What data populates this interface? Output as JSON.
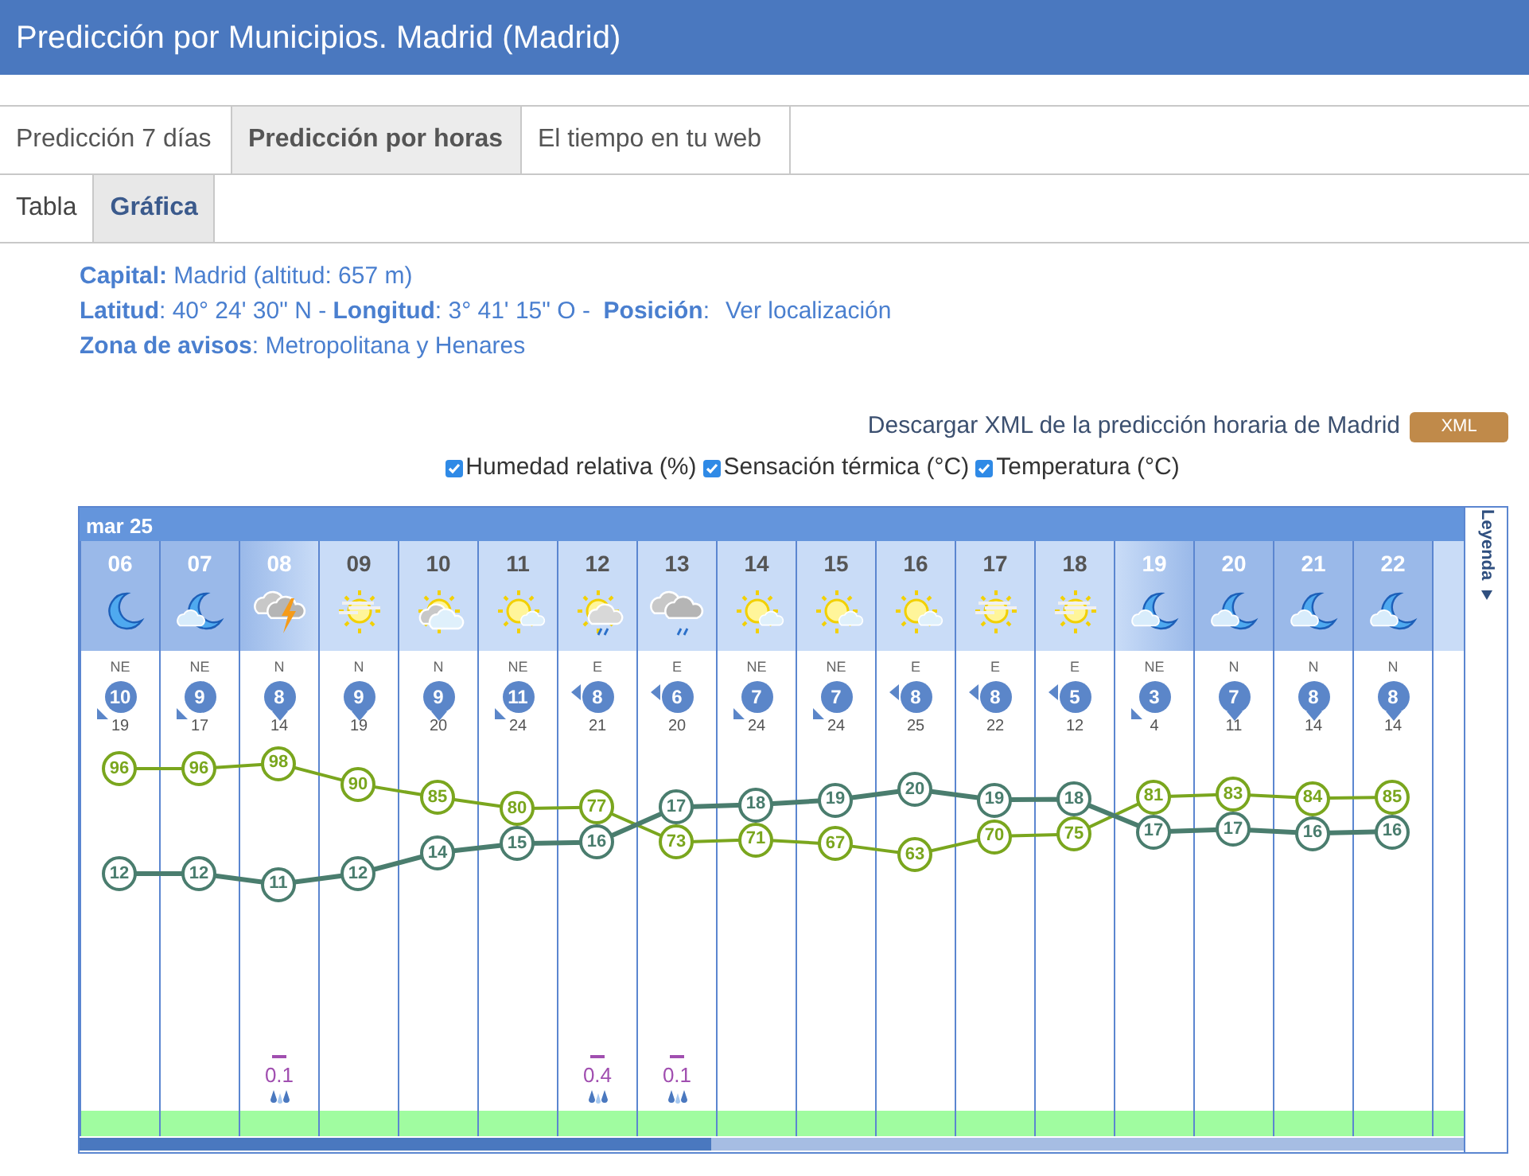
{
  "window": {
    "title": "Predicción por Municipios. Madrid (Madrid)"
  },
  "tabs": [
    {
      "label": "Predicción 7 días",
      "selected": false
    },
    {
      "label": "Predicción por horas",
      "selected": true
    },
    {
      "label": "El tiempo en tu web",
      "selected": false
    }
  ],
  "subtabs": [
    {
      "label": "Tabla",
      "selected": false
    },
    {
      "label": "Gráfica",
      "selected": true
    }
  ],
  "info": [
    {
      "kind": "text",
      "text": "**Capital:** Madrid (altitud: 657 m)"
    },
    {
      "kind": "link",
      "text": "**Latitud**: 40° 24' 30\" N - **Longitud**: 3° 41' 15\" O -  **Posición**:",
      "link": "Ver localización"
    },
    {
      "kind": "text",
      "text": "**Zona de avisos**: Metropolitana y Henares"
    }
  ],
  "download": {
    "text": "Descargar XML de la predicción horaria de Madrid",
    "button": "XML"
  },
  "series_toggles": [
    {
      "label": "Humedad relativa (%)",
      "checked": true
    },
    {
      "label": "Sensación térmica (°C)",
      "checked": true
    },
    {
      "label": "Temperatura (°C)",
      "checked": true
    }
  ],
  "chart": {
    "date": "mar 25",
    "legend": "Leyenda",
    "hours": [
      {
        "hour": "06",
        "header": {
          "kind": "night"
        },
        "sky": {
          "kind": "moon"
        },
        "wind_dir": "NE",
        "wind": "10",
        "wind_arrow": {
          "kind": "sw"
        },
        "gust": "19",
        "humidity": "96",
        "temperature": "12"
      },
      {
        "hour": "07",
        "header": {
          "kind": "night"
        },
        "sky": {
          "kind": "moon_cloud"
        },
        "wind_dir": "NE",
        "wind": "9",
        "wind_arrow": {
          "kind": "sw"
        },
        "gust": "17",
        "humidity": "96",
        "temperature": "12"
      },
      {
        "hour": "08",
        "header": {
          "kind": "dawn"
        },
        "sky": {
          "kind": "storm"
        },
        "wind_dir": "N",
        "wind": "8",
        "wind_arrow": {
          "kind": "s"
        },
        "gust": "14",
        "humidity": "98",
        "temperature": "11",
        "rain": "0.1"
      },
      {
        "hour": "09",
        "header": {
          "kind": "day"
        },
        "sky": {
          "kind": "sun_haze"
        },
        "wind_dir": "N",
        "wind": "9",
        "wind_arrow": {
          "kind": "s"
        },
        "gust": "19",
        "humidity": "90",
        "temperature": "12"
      },
      {
        "hour": "10",
        "header": {
          "kind": "day"
        },
        "sky": {
          "kind": "sun_cloud"
        },
        "wind_dir": "N",
        "wind": "9",
        "wind_arrow": {
          "kind": "s"
        },
        "gust": "20",
        "humidity": "85",
        "temperature": "14"
      },
      {
        "hour": "11",
        "header": {
          "kind": "day"
        },
        "sky": {
          "kind": "sun_small_cloud"
        },
        "wind_dir": "NE",
        "wind": "11",
        "wind_arrow": {
          "kind": "sw"
        },
        "gust": "24",
        "humidity": "80",
        "temperature": "15"
      },
      {
        "hour": "12",
        "header": {
          "kind": "day"
        },
        "sky": {
          "kind": "sun_cloud_rain"
        },
        "wind_dir": "E",
        "wind": "8",
        "wind_arrow": {
          "kind": "w"
        },
        "gust": "21",
        "humidity": "77",
        "temperature": "16",
        "rain": "0.4"
      },
      {
        "hour": "13",
        "header": {
          "kind": "day"
        },
        "sky": {
          "kind": "cloud_rain"
        },
        "wind_dir": "E",
        "wind": "6",
        "wind_arrow": {
          "kind": "w"
        },
        "gust": "20",
        "humidity": "73",
        "temperature": "17",
        "rain": "0.1"
      },
      {
        "hour": "14",
        "header": {
          "kind": "day"
        },
        "sky": {
          "kind": "sun_small_cloud"
        },
        "wind_dir": "NE",
        "wind": "7",
        "wind_arrow": {
          "kind": "sw"
        },
        "gust": "24",
        "humidity": "71",
        "temperature": "18"
      },
      {
        "hour": "15",
        "header": {
          "kind": "day"
        },
        "sky": {
          "kind": "sun_small_cloud"
        },
        "wind_dir": "NE",
        "wind": "7",
        "wind_arrow": {
          "kind": "sw"
        },
        "gust": "24",
        "humidity": "67",
        "temperature": "19"
      },
      {
        "hour": "16",
        "header": {
          "kind": "day"
        },
        "sky": {
          "kind": "sun_small_cloud"
        },
        "wind_dir": "E",
        "wind": "8",
        "wind_arrow": {
          "kind": "w"
        },
        "gust": "25",
        "humidity": "63",
        "temperature": "20"
      },
      {
        "hour": "17",
        "header": {
          "kind": "day"
        },
        "sky": {
          "kind": "sun_haze"
        },
        "wind_dir": "E",
        "wind": "8",
        "wind_arrow": {
          "kind": "w"
        },
        "gust": "22",
        "humidity": "70",
        "temperature": "19"
      },
      {
        "hour": "18",
        "header": {
          "kind": "day"
        },
        "sky": {
          "kind": "sun_haze"
        },
        "wind_dir": "E",
        "wind": "5",
        "wind_arrow": {
          "kind": "w"
        },
        "gust": "12",
        "humidity": "75",
        "temperature": "18"
      },
      {
        "hour": "19",
        "header": {
          "kind": "dusk"
        },
        "sky": {
          "kind": "moon_cloud"
        },
        "wind_dir": "NE",
        "wind": "3",
        "wind_arrow": {
          "kind": "sw"
        },
        "gust": "4",
        "humidity": "81",
        "temperature": "17"
      },
      {
        "hour": "20",
        "header": {
          "kind": "night"
        },
        "sky": {
          "kind": "moon_cloud"
        },
        "wind_dir": "N",
        "wind": "7",
        "wind_arrow": {
          "kind": "s"
        },
        "gust": "11",
        "humidity": "83",
        "temperature": "17"
      },
      {
        "hour": "21",
        "header": {
          "kind": "night"
        },
        "sky": {
          "kind": "moon_cloud"
        },
        "wind_dir": "N",
        "wind": "8",
        "wind_arrow": {
          "kind": "s"
        },
        "gust": "14",
        "humidity": "84",
        "temperature": "16"
      },
      {
        "hour": "22",
        "header": {
          "kind": "night"
        },
        "sky": {
          "kind": "moon_cloud"
        },
        "wind_dir": "N",
        "wind": "8",
        "wind_arrow": {
          "kind": "s"
        },
        "gust": "14",
        "humidity": "85",
        "temperature": "16"
      }
    ]
  }
}
